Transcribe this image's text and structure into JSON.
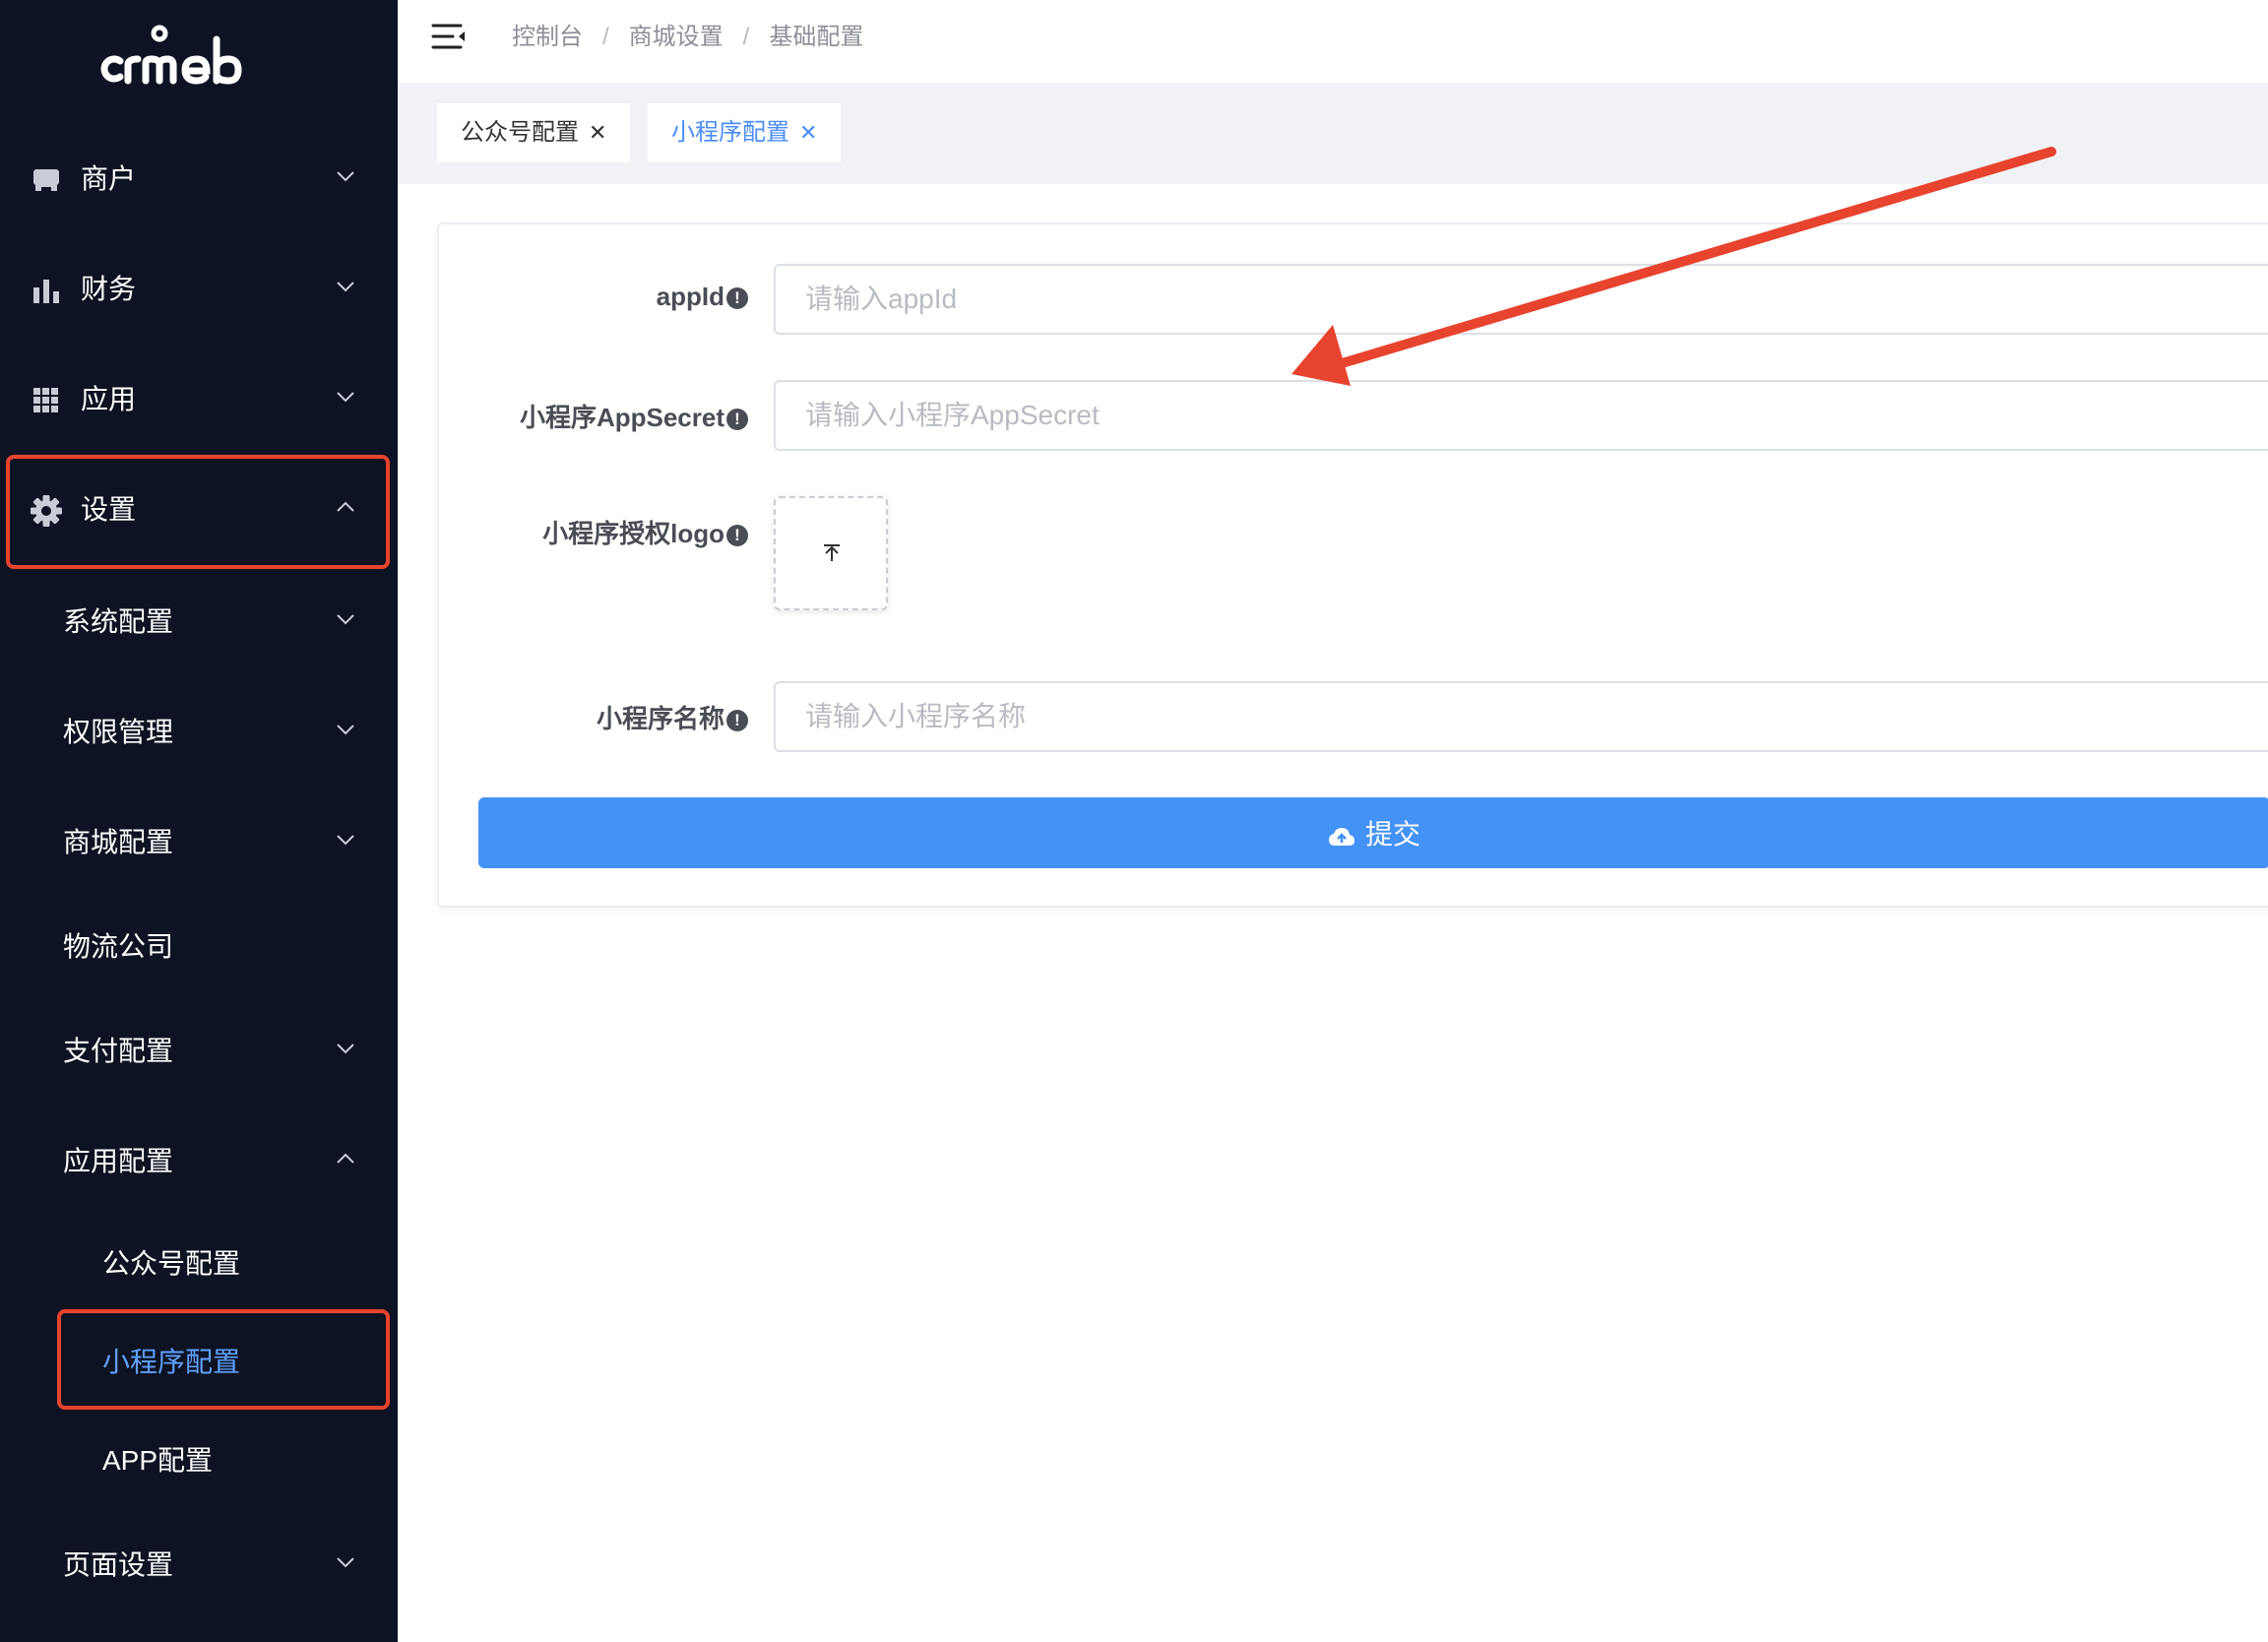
{
  "logo": {
    "text": "crmeb"
  },
  "sidebar": {
    "top_items": [
      {
        "label": "商户",
        "icon": "store-icon"
      },
      {
        "label": "财务",
        "icon": "bar-chart-icon"
      },
      {
        "label": "应用",
        "icon": "grid-icon"
      },
      {
        "label": "设置",
        "icon": "gear-icon"
      }
    ],
    "sub_items": [
      {
        "label": "系统配置"
      },
      {
        "label": "权限管理"
      },
      {
        "label": "商城配置"
      },
      {
        "label": "物流公司"
      },
      {
        "label": "支付配置"
      },
      {
        "label": "应用配置"
      }
    ],
    "app_config_items": [
      {
        "label": "公众号配置"
      },
      {
        "label": "小程序配置"
      },
      {
        "label": "APP配置"
      }
    ],
    "last_item": {
      "label": "页面设置"
    }
  },
  "header": {
    "breadcrumb": [
      "控制台",
      "商城设置",
      "基础配置"
    ],
    "separator": "/"
  },
  "tags": [
    {
      "label": "公众号配置",
      "active": false
    },
    {
      "label": "小程序配置",
      "active": true
    }
  ],
  "form": {
    "fields": [
      {
        "label": "appId",
        "placeholder": "请输入appId",
        "value": ""
      },
      {
        "label": "小程序AppSecret",
        "placeholder": "请输入小程序AppSecret",
        "value": ""
      },
      {
        "label": "小程序授权logo"
      },
      {
        "label": "小程序名称",
        "placeholder": "请输入小程序名称",
        "value": ""
      }
    ],
    "submit_label": "提交"
  },
  "colors": {
    "sidebar_bg": "#0d1322",
    "accent": "#4392f6",
    "highlight_box": "#e8432e",
    "annotation_arrow": "#e8432e"
  }
}
